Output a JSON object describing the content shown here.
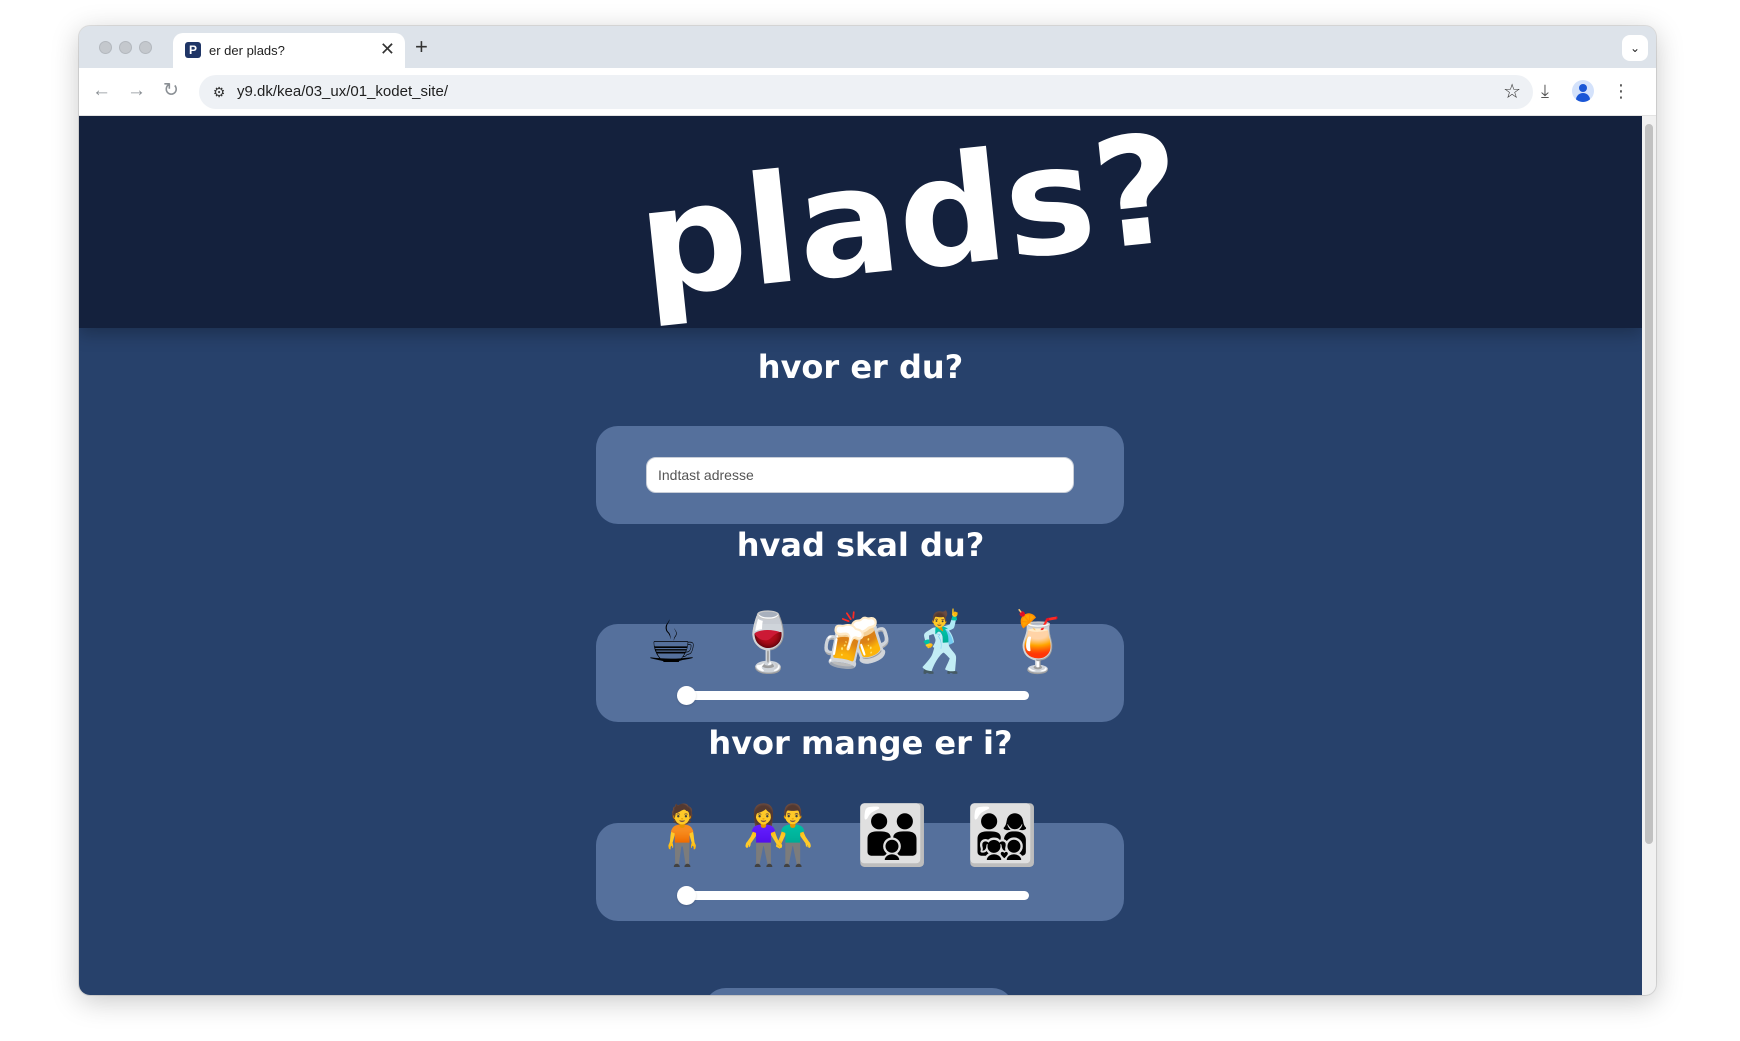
{
  "browser": {
    "tab_title": "er der plads?",
    "tab_favicon": "P",
    "tab_close": "✕",
    "new_tab": "+",
    "tab_menu": "⌄",
    "back": "←",
    "forward": "→",
    "reload": "↻",
    "url": "y9.dk/kea/03_ux/01_kodet_site/",
    "bookmark_star": "☆",
    "site_settings_icon": "⚙",
    "download_icon": "⤓",
    "menu_icon": "⋮"
  },
  "page": {
    "logo_text": "plads?",
    "location": {
      "heading": "hvor er du?",
      "address_placeholder": "Indtast adresse",
      "address_value": ""
    },
    "activity": {
      "heading": "hvad skal du?",
      "options": [
        "☕",
        "🍷",
        "🍻",
        "🕺",
        "🍹"
      ],
      "option_icons": [
        "coffee-icon",
        "wine-glass-icon",
        "beer-mugs-icon",
        "dancing-man-icon",
        "tropical-drink-icon"
      ],
      "slider_value": 0
    },
    "group": {
      "heading": "hvor mange er i?",
      "options": [
        "🧍",
        "👫",
        "👪",
        "👨‍👩‍👧‍👦"
      ],
      "option_icons": [
        "one-person-icon",
        "couple-icon",
        "family-icon",
        "large-family-icon"
      ],
      "slider_value": 0
    }
  },
  "colors": {
    "hero": "#14213d",
    "page_bg": "#27416b",
    "panel": "#55709c",
    "text": "#ffffff"
  }
}
